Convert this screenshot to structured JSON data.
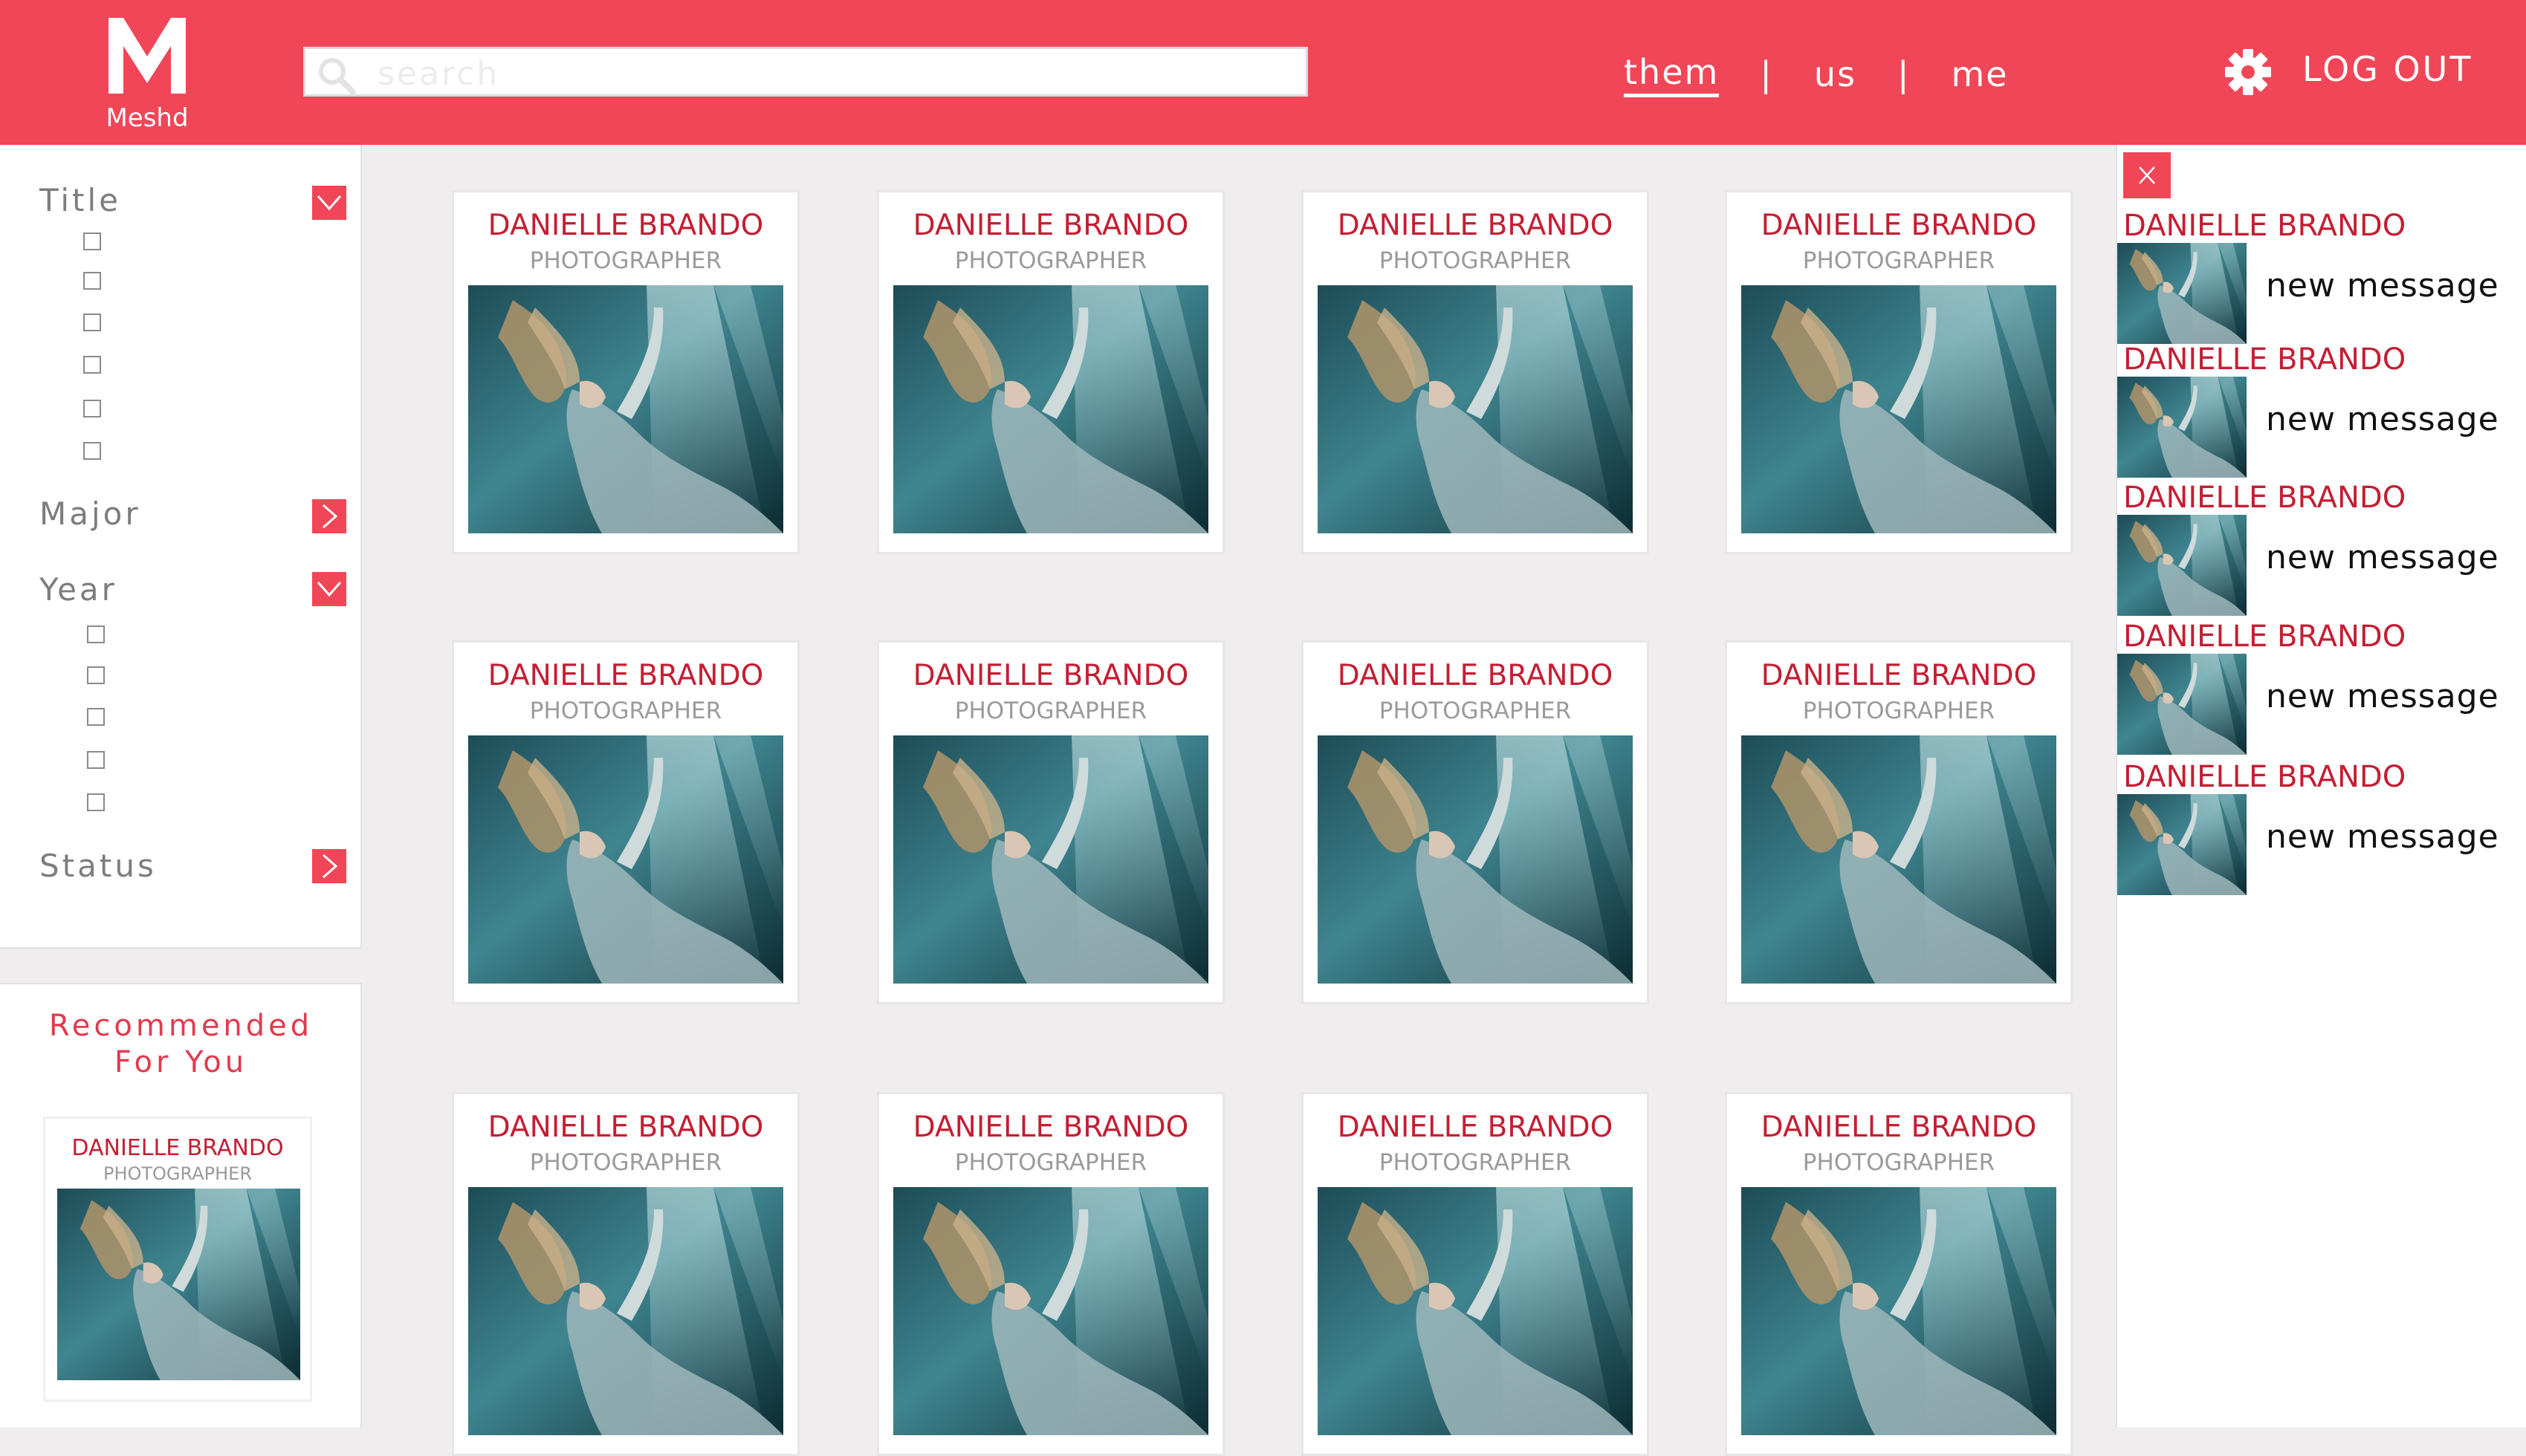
{
  "app": {
    "name": "Meshd",
    "logo_letter": "M"
  },
  "header": {
    "search_placeholder": "search",
    "nav": [
      {
        "label": "them",
        "active": true
      },
      {
        "label": "us",
        "active": false
      },
      {
        "label": "me",
        "active": false
      }
    ],
    "nav_separator": "|",
    "logout_label": "LOG OUT"
  },
  "filters": [
    {
      "label": "Title",
      "expanded": true,
      "checkbox_count": 6
    },
    {
      "label": "Major",
      "expanded": false,
      "checkbox_count": 0
    },
    {
      "label": "Year",
      "expanded": true,
      "checkbox_count": 5
    },
    {
      "label": "Status",
      "expanded": false,
      "checkbox_count": 0
    }
  ],
  "recommended": {
    "title_line1": "Recommended",
    "title_line2": "For You",
    "card": {
      "name": "DANIELLE BRANDO",
      "role": "PHOTOGRAPHER"
    }
  },
  "people": [
    {
      "name": "DANIELLE BRANDO",
      "role": "PHOTOGRAPHER"
    },
    {
      "name": "DANIELLE BRANDO",
      "role": "PHOTOGRAPHER"
    },
    {
      "name": "DANIELLE BRANDO",
      "role": "PHOTOGRAPHER"
    },
    {
      "name": "DANIELLE BRANDO",
      "role": "PHOTOGRAPHER"
    },
    {
      "name": "DANIELLE BRANDO",
      "role": "PHOTOGRAPHER"
    },
    {
      "name": "DANIELLE BRANDO",
      "role": "PHOTOGRAPHER"
    },
    {
      "name": "DANIELLE BRANDO",
      "role": "PHOTOGRAPHER"
    },
    {
      "name": "DANIELLE BRANDO",
      "role": "PHOTOGRAPHER"
    },
    {
      "name": "DANIELLE BRANDO",
      "role": "PHOTOGRAPHER"
    },
    {
      "name": "DANIELLE BRANDO",
      "role": "PHOTOGRAPHER"
    },
    {
      "name": "DANIELLE BRANDO",
      "role": "PHOTOGRAPHER"
    },
    {
      "name": "DANIELLE BRANDO",
      "role": "PHOTOGRAPHER"
    }
  ],
  "messages": {
    "close_label": "X",
    "items": [
      {
        "name": "DANIELLE BRANDO",
        "text": "new message"
      },
      {
        "name": "DANIELLE BRANDO",
        "text": "new message"
      },
      {
        "name": "DANIELLE BRANDO",
        "text": "new message"
      },
      {
        "name": "DANIELLE BRANDO",
        "text": "new message"
      },
      {
        "name": "DANIELLE BRANDO",
        "text": "new message"
      }
    ]
  },
  "colors": {
    "brand": "#f14657",
    "name_red": "#c41e33",
    "background": "#efedee"
  },
  "icons": [
    "search-icon",
    "gear-icon",
    "chevron-down-icon",
    "chevron-right-icon",
    "close-icon"
  ]
}
